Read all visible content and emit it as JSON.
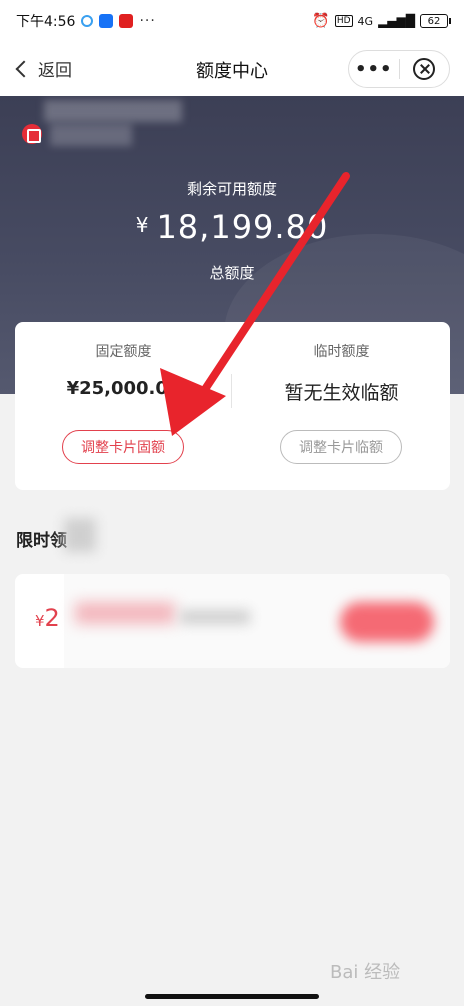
{
  "status_bar": {
    "time": "下午4:56",
    "app_badge_1": "知乎",
    "app_badge_2": "头条",
    "more": "···",
    "network": "4G",
    "battery": "62",
    "hd": "HD"
  },
  "nav": {
    "back_label": "返回",
    "title": "额度中心",
    "more_label": "•••"
  },
  "hero": {
    "remaining_label": "剩余可用额度",
    "currency": "¥",
    "remaining_amount": "18,199.80",
    "total_label": "总额度"
  },
  "credit": {
    "fixed_label": "固定额度",
    "fixed_value": "¥25,000.00",
    "fixed_button": "调整卡片固额",
    "temp_label": "临时额度",
    "temp_value": "暂无生效临额",
    "temp_button": "调整卡片临额"
  },
  "limited": {
    "title": "限时领",
    "promo_currency": "¥",
    "promo_amount": "2"
  },
  "watermark": "Bai 经验",
  "colors": {
    "accent_red": "#e2414d",
    "hero_bg": "#474b62"
  }
}
